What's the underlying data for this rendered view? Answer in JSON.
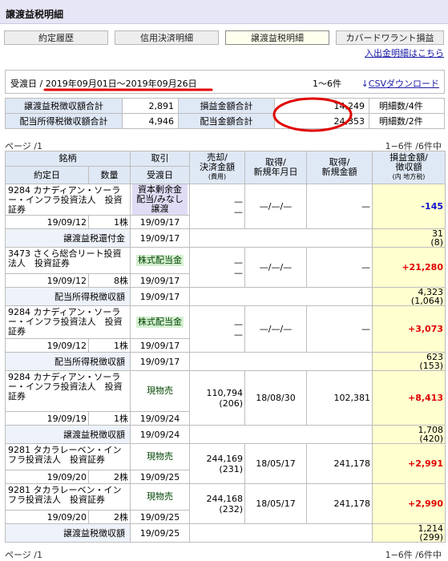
{
  "header": {
    "title": "譲渡益税明細"
  },
  "tabs": [
    "約定履歴",
    "信用決済明細",
    "譲渡益税明細",
    "カバードワラント損益"
  ],
  "links": {
    "deposit_history": "入出金明細はこちら"
  },
  "filter": {
    "label": "受渡日 / 2019年09月01日〜2019年09月26日",
    "range": "1〜6件",
    "csv": "CSVダウンロード"
  },
  "summary": {
    "rows": [
      {
        "h1": "譲渡益税徴収額合計",
        "v1": "2,891",
        "h2": "損益金額合計",
        "v2": "14,249",
        "c": "明細数/4件"
      },
      {
        "h1": "配当所得税徴収額合計",
        "v1": "4,946",
        "h2": "配当金額合計",
        "v2": "24,353",
        "c": "明細数/2件"
      }
    ]
  },
  "pager": {
    "page": "ページ /1",
    "count": "1−6件 /6件中"
  },
  "headers": {
    "brand": "銘柄",
    "trade_date": "約定日",
    "qty": "数量",
    "torihiki": "取引",
    "ukewatashi": "受渡日",
    "sell_line1": "売却/",
    "sell_line2": "決済金額",
    "sell_sub": "(費用)",
    "acq_line1": "取得/",
    "acq_line2": "新規年月日",
    "acqamt_line1": "取得/",
    "acqamt_line2": "新規金額",
    "pl_line1": "損益金額/",
    "pl_line2": "徴収額",
    "pl_sub": "(内 地方税)"
  },
  "items": [
    {
      "name": "9284 カナディアン・ソーラー・インフラ投資法人　投資証券",
      "date": "19/09/12",
      "qty": "1株",
      "type": "資本剰余金配当/みなし譲渡",
      "settle": "19/09/17",
      "sell": "—",
      "sell_fee": "—",
      "acq_date": "—/—/—",
      "acq_amt": "—",
      "pl": "-145",
      "tax_label": "譲渡益税還付金",
      "tax_date": "19/09/17",
      "tax": "31",
      "tax_local": "(8)"
    },
    {
      "name": "3473 さくら総合リート投資法人　投資証券",
      "date": "19/09/12",
      "qty": "8株",
      "type": "株式配当金",
      "settle": "19/09/17",
      "sell": "—",
      "sell_fee": "—",
      "acq_date": "—/—/—",
      "acq_amt": "—",
      "pl": "+21,280",
      "tax_label": "配当所得税徴収額",
      "tax_date": "19/09/17",
      "tax": "4,323",
      "tax_local": "(1,064)"
    },
    {
      "name": "9284 カナディアン・ソーラー・インフラ投資法人　投資証券",
      "date": "19/09/12",
      "qty": "1株",
      "type": "株式配当金",
      "settle": "19/09/17",
      "sell": "—",
      "sell_fee": "—",
      "acq_date": "—/—/—",
      "acq_amt": "—",
      "pl": "+3,073",
      "tax_label": "配当所得税徴収額",
      "tax_date": "19/09/17",
      "tax": "623",
      "tax_local": "(153)"
    },
    {
      "name": "9284 カナディアン・ソーラー・インフラ投資法人　投資証券",
      "date": "19/09/19",
      "qty": "1株",
      "type": "現物売",
      "settle": "19/09/24",
      "sell": "110,794",
      "sell_fee": "(206)",
      "acq_date": "18/08/30",
      "acq_amt": "102,381",
      "pl": "+8,413",
      "tax_label": "譲渡益税徴収額",
      "tax_date": "19/09/24",
      "tax": "1,708",
      "tax_local": "(420)"
    },
    {
      "name": "9281 タカラレーベン・インフラ投資法人　投資証券",
      "date": "19/09/20",
      "qty": "2株",
      "type": "現物売",
      "settle": "19/09/25",
      "sell": "244,169",
      "sell_fee": "(231)",
      "acq_date": "18/05/17",
      "acq_amt": "241,178",
      "pl": "+2,991"
    },
    {
      "name": "9281 タカラレーベン・インフラ投資法人　投資証券",
      "date": "19/09/20",
      "qty": "2株",
      "type": "現物売",
      "settle": "19/09/25",
      "sell": "244,168",
      "sell_fee": "(232)",
      "acq_date": "18/05/17",
      "acq_amt": "241,178",
      "pl": "+2,990",
      "tax_label": "譲渡益税徴収額",
      "tax_date": "19/09/25",
      "tax": "1,214",
      "tax_local": "(299)"
    }
  ],
  "colors": {
    "header_bg": "#dfe8f5",
    "pl_bg": "#ffffd0",
    "gain": "#e00000",
    "loss": "#1010d0",
    "annotation": "#e00000"
  }
}
